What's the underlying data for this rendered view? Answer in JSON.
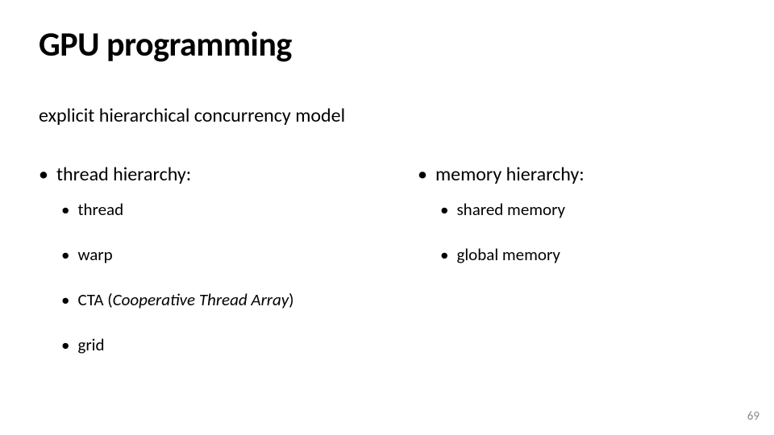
{
  "title": "GPU programming",
  "subtitle": "explicit hierarchical concurrency model",
  "left": {
    "heading": "thread hierarchy:",
    "items": [
      {
        "text": "thread",
        "italic": false
      },
      {
        "text": "warp",
        "italic": false
      },
      {
        "text_prefix": "CTA (",
        "text_italic": "Cooperative Thread Array",
        "text_suffix": ")",
        "composite": true
      },
      {
        "text": "grid",
        "italic": false
      }
    ]
  },
  "right": {
    "heading": "memory hierarchy:",
    "items": [
      {
        "text": "shared memory"
      },
      {
        "text": "global memory"
      }
    ]
  },
  "page_number": "69",
  "bullet_glyph": "•"
}
